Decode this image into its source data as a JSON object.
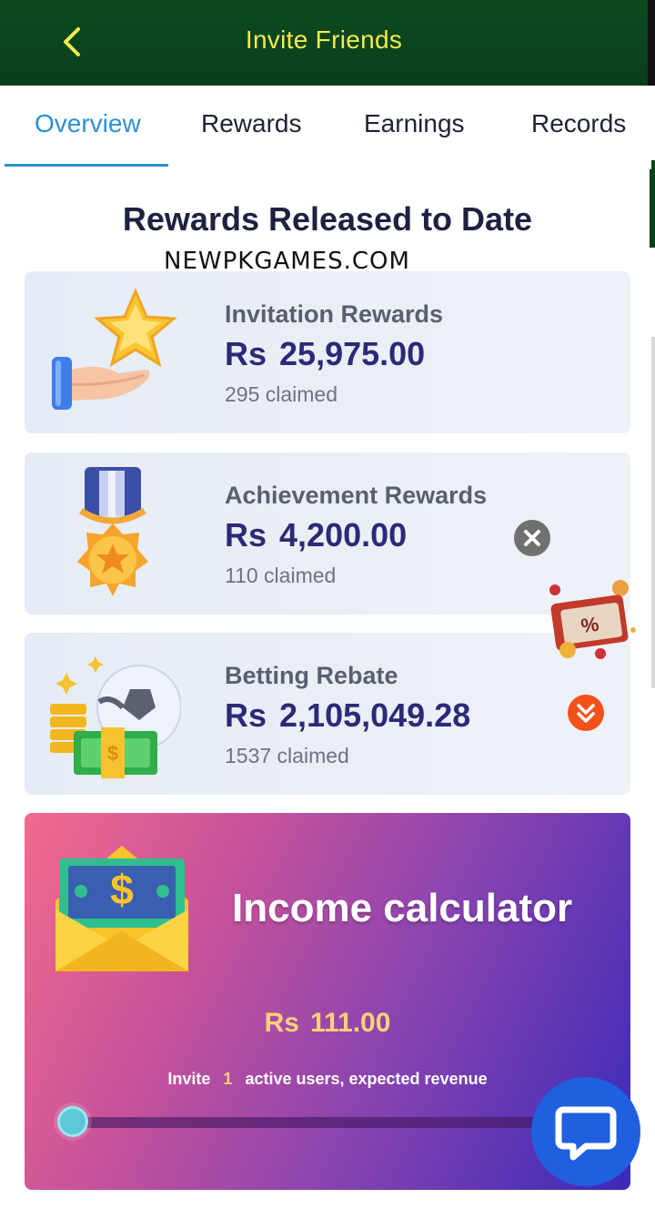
{
  "header": {
    "title": "Invite Friends",
    "back_icon": "chevron-left-icon",
    "background": "#0a421c",
    "title_color": "#f2ea4e"
  },
  "tabs": [
    {
      "label": "Overview",
      "active": true
    },
    {
      "label": "Rewards",
      "active": false
    },
    {
      "label": "Earnings",
      "active": false
    },
    {
      "label": "Records",
      "active": false
    }
  ],
  "accent_color": "#2b8fd6",
  "section": {
    "title": "Rewards Released to Date",
    "watermark": "NEWPKGAMES.COM"
  },
  "rewards": [
    {
      "label": "Invitation Rewards",
      "currency": "Rs",
      "amount": "25,975.00",
      "claimed": "295 claimed",
      "icon": "hand-star-icon"
    },
    {
      "label": "Achievement Rewards",
      "currency": "Rs",
      "amount": "4,200.00",
      "claimed": "110 claimed",
      "icon": "medal-icon"
    },
    {
      "label": "Betting Rebate",
      "currency": "Rs",
      "amount": "2,105,049.28",
      "claimed": "1537 claimed",
      "icon": "coins-football-cash-icon"
    }
  ],
  "calculator": {
    "title": "Income calculator",
    "currency": "Rs",
    "amount": "111.00",
    "caption_prefix": "Invite",
    "active_users": "1",
    "caption_suffix": "active users, expected revenue",
    "slider_fraction": 0.0,
    "icon": "money-envelope-icon"
  },
  "floating": {
    "close_icon": "close-icon",
    "promo_icon": "gift-coupon-icon",
    "scroll_icon": "double-chevron-down-icon",
    "chat_icon": "chat-bubble-icon"
  }
}
